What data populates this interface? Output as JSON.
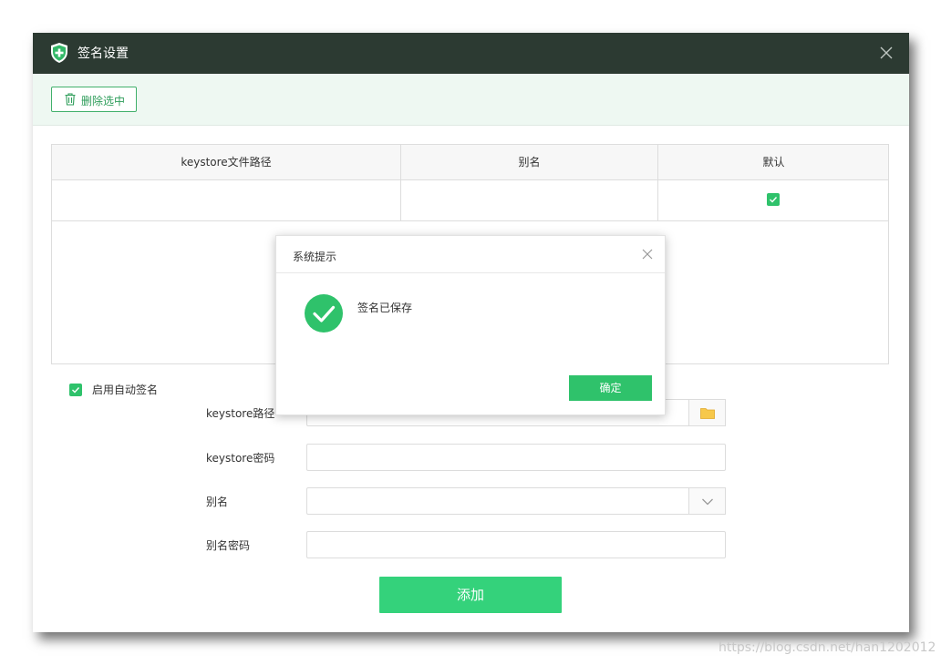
{
  "window": {
    "title": "签名设置",
    "icon": "shield-plus-icon",
    "accent": "#2fc26b",
    "titlebar_color": "#2c3a32"
  },
  "toolbar": {
    "delete_label": "删除选中"
  },
  "table": {
    "columns": [
      "keystore文件路径",
      "别名",
      "默认"
    ],
    "rows": [
      {
        "path": "",
        "alias": "",
        "default_checked": true
      }
    ]
  },
  "form": {
    "auto_sign_label": "启用自动签名",
    "auto_sign_checked": true,
    "keystore_path_label": "keystore路径",
    "keystore_path_value": "",
    "keystore_password_label": "keystore密码",
    "keystore_password_value": "",
    "alias_label": "别名",
    "alias_value": "",
    "alias_password_label": "别名密码",
    "alias_password_value": "",
    "add_button_label": "添加"
  },
  "dialog": {
    "title": "系统提示",
    "message": "签名已保存",
    "ok_label": "确定",
    "icon": "success-check-icon"
  },
  "watermark": "https://blog.csdn.net/han1202012"
}
